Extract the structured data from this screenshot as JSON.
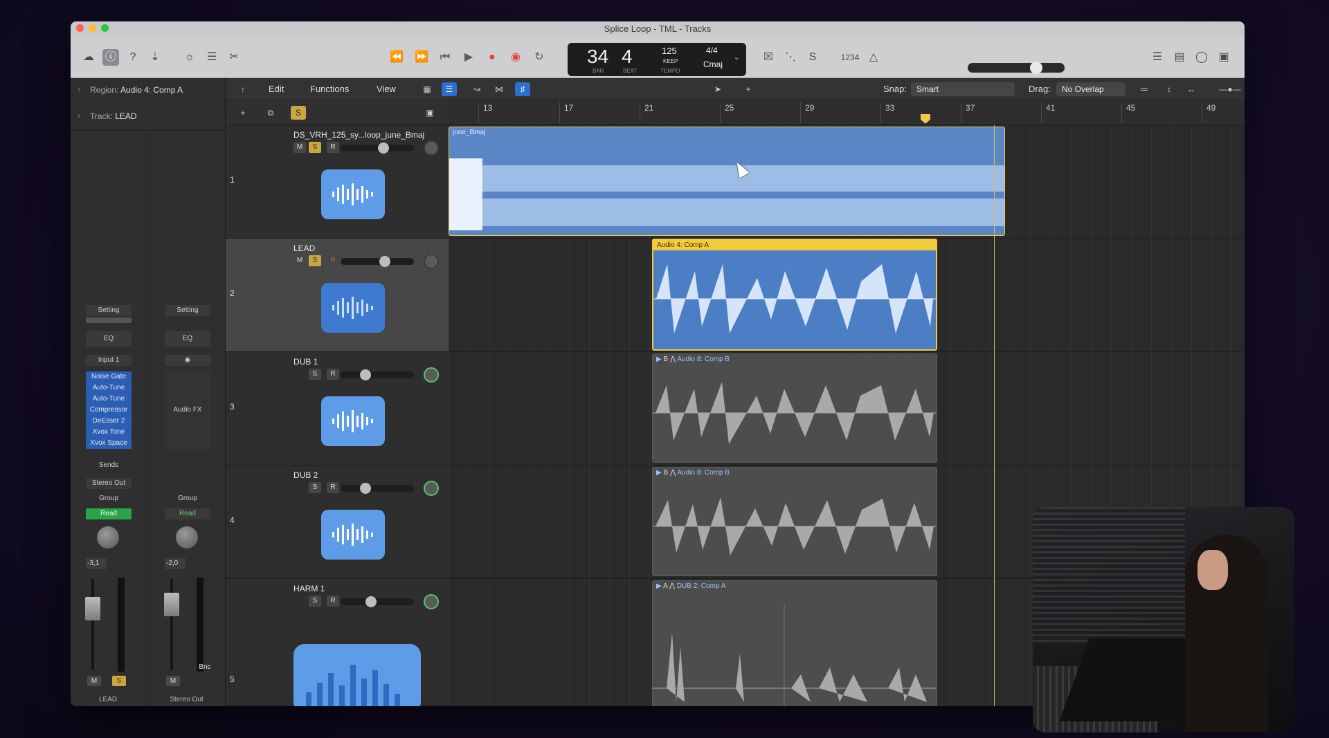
{
  "window": {
    "title": "Splice Loop - TML - Tracks"
  },
  "lcd": {
    "bar": "34",
    "beat": "4",
    "bar_label": "BAR",
    "beat_label": "BEAT",
    "tempo": "125",
    "tempo_mode": "KEEP",
    "tempo_label": "TEMPO",
    "time_signature": "4/4",
    "key": "Cmaj"
  },
  "controlbar": {
    "count_in": "1234"
  },
  "inspector": {
    "region_label": "Region:",
    "region_value": "Audio 4: Comp A",
    "track_label": "Track:",
    "track_value": "LEAD",
    "strip1": {
      "setting": "Setting",
      "eq": "EQ",
      "input": "Input 1",
      "plugins": [
        "Noise Gate",
        "Auto-Tune",
        "Auto-Tune",
        "Compressor",
        "DeEsser 2",
        "Xvox Tone",
        "Xvox Space"
      ],
      "sends": "Sends",
      "output": "Stereo Out",
      "group": "Group",
      "automation": "Read",
      "pan_value": "-3,1",
      "mute": "M",
      "solo": "S",
      "name": "LEAD"
    },
    "strip2": {
      "setting": "Setting",
      "eq": "EQ",
      "audio_fx": "Audio FX",
      "group": "Group",
      "automation": "Read",
      "pan_value": "-2,0",
      "bounce": "Bnc",
      "mute": "M",
      "name": "Stereo Out"
    }
  },
  "trackbar": {
    "edit": "Edit",
    "functions": "Functions",
    "view": "View",
    "snap_label": "Snap:",
    "snap_value": "Smart",
    "drag_label": "Drag:",
    "drag_value": "No Overlap"
  },
  "ruler": {
    "bars": [
      "13",
      "17",
      "21",
      "25",
      "29",
      "33",
      "37",
      "41",
      "45",
      "49"
    ]
  },
  "tracks": [
    {
      "number": "1",
      "name": "DS_VRH_125_sy...loop_june_Bmaj",
      "mute": "M",
      "solo": "S",
      "record": "R",
      "region_label": "june_Bmaj"
    },
    {
      "number": "2",
      "name": "LEAD",
      "mute": "M",
      "solo": "S",
      "record": "R",
      "region_label": "Audio 4: Comp A"
    },
    {
      "number": "3",
      "name": "DUB 1",
      "solo": "S",
      "record": "R",
      "region_take": "B",
      "region_label": "Audio 8: Comp B"
    },
    {
      "number": "4",
      "name": "DUB 2",
      "solo": "S",
      "record": "R",
      "region_take": "B",
      "region_label": "Audio 8: Comp B"
    },
    {
      "number": "5",
      "name": "HARM 1",
      "solo": "S",
      "record": "R",
      "region_take": "A",
      "region_label": "DUB 2: Comp A"
    }
  ],
  "colors": {
    "region_blue": "#5b86c6",
    "selected_region_border": "#f1cb3b",
    "solo": "#c9a640",
    "record": "#e0584f",
    "read": "#2aa44a"
  }
}
